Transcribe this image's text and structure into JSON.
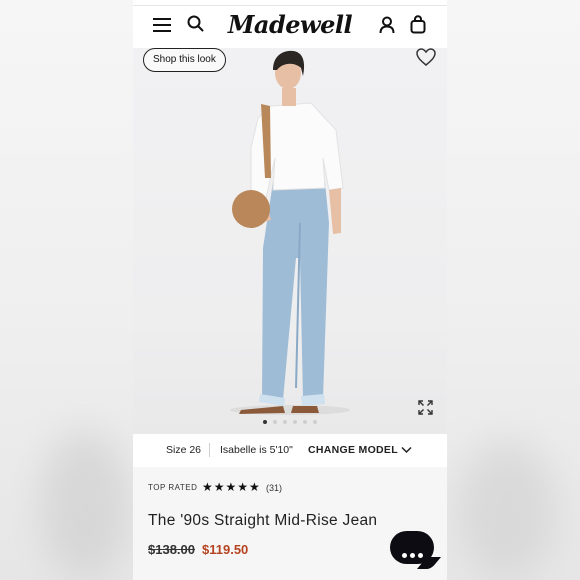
{
  "header": {
    "brand": "Madewell",
    "menu_icon": "hamburger-menu-icon",
    "search_icon": "search-icon",
    "account_icon": "account-icon",
    "bag_icon": "shopping-bag-icon"
  },
  "hero": {
    "shop_look_label": "Shop this look",
    "favorite_icon": "heart-icon",
    "expand_icon": "expand-icon",
    "carousel_total": 6,
    "carousel_active": 1
  },
  "model_info": {
    "size": "Size 26",
    "model": "Isabelle is 5'10\"",
    "change_label": "CHANGE MODEL"
  },
  "product": {
    "badge": "TOP RATED",
    "stars": "★★★★★",
    "review_count": "(31)",
    "title": "The '90s Straight Mid-Rise Jean",
    "original_price": "$138.00",
    "sale_price": "$119.50",
    "sale_color": "#b5431f"
  },
  "chat": {
    "icon": "chat-bubble-icon"
  }
}
